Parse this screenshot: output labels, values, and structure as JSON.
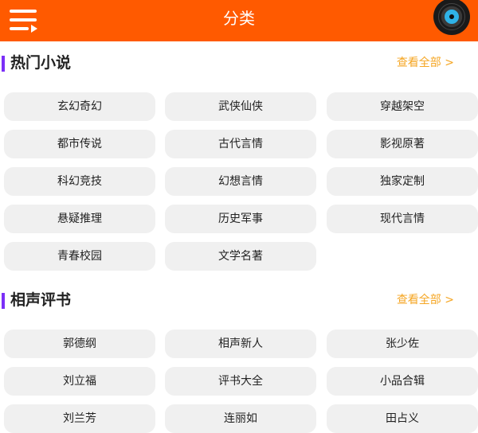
{
  "header": {
    "title": "分类",
    "menu_icon": "menu-icon",
    "record_icon": "vinyl-record-icon"
  },
  "sections": [
    {
      "title": "热门小说",
      "more": "查看全部 >",
      "items": [
        "玄幻奇幻",
        "武侠仙侠",
        "穿越架空",
        "都市传说",
        "古代言情",
        "影视原著",
        "科幻竞技",
        "幻想言情",
        "独家定制",
        "悬疑推理",
        "历史军事",
        "现代言情",
        "青春校园",
        "文学名著"
      ]
    },
    {
      "title": "相声评书",
      "more": "查看全部 >",
      "items": [
        "郭德纲",
        "相声新人",
        "张少佐",
        "刘立福",
        "评书大全",
        "小品合辑",
        "刘兰芳",
        "连丽如",
        "田占义"
      ]
    }
  ],
  "colors": {
    "header_bg": "#ff5a00",
    "accent_bar": "#7b2ff7",
    "more_link": "#f5a623",
    "cell_bg": "#f0f0f0"
  }
}
